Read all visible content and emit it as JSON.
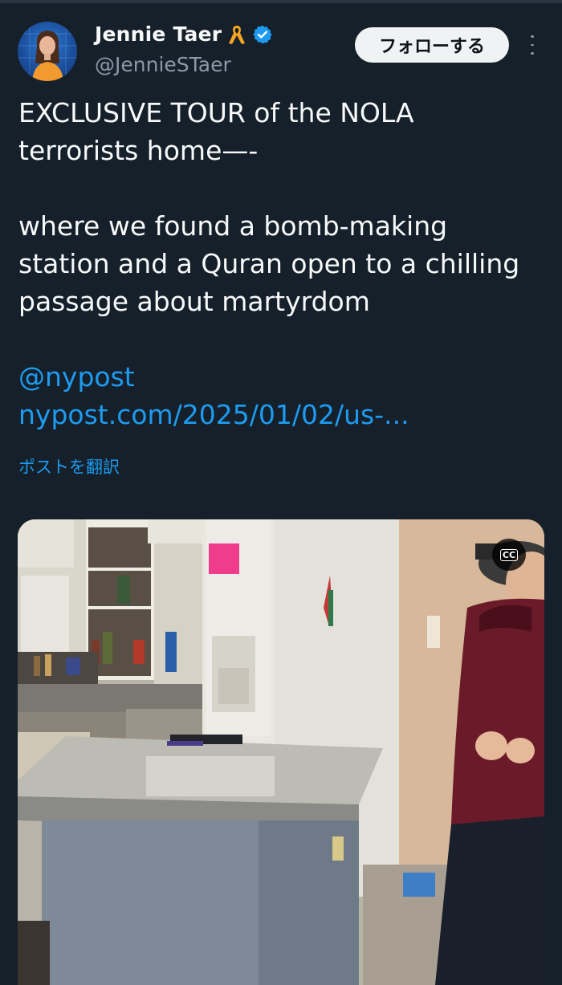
{
  "author": {
    "display_name": "Jennie Taer",
    "handle": "@JennieSTaer"
  },
  "follow_button": {
    "label": "フォローする"
  },
  "tweet": {
    "paragraphs": [
      "EXCLUSIVE TOUR of the NOLA terrorists home—-",
      "where we found a bomb-making station and a Quran open to a chilling passage about martyrdom"
    ],
    "mention": "@nypost",
    "link": "nypost.com/2025/01/02/us-..."
  },
  "translate_label": "ポストを翻訳",
  "media": {
    "cc_label": "CC"
  },
  "colors": {
    "background": "#15202b",
    "text": "#f7f9f9",
    "muted": "#8b98a5",
    "link": "#1d9bf0",
    "verified": "#1d9bf0",
    "ribbon": "#f5a623"
  },
  "icons": [
    "awareness-ribbon-icon",
    "verified-badge-icon",
    "more-options-icon",
    "closed-captions-icon"
  ]
}
